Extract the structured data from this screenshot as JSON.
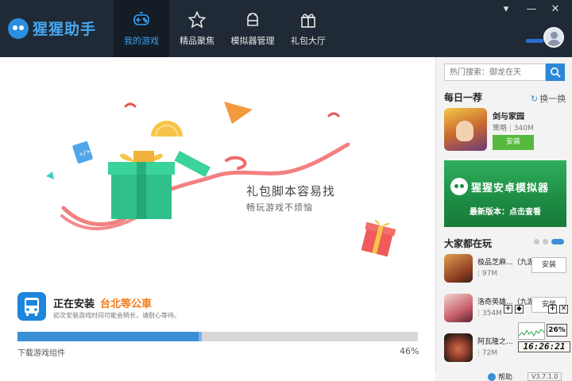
{
  "app": {
    "name": "猩猩助手",
    "nav": [
      {
        "label": "我的游戏",
        "icon": "gamepad-icon",
        "active": true
      },
      {
        "label": "精品聚焦",
        "icon": "star-icon",
        "active": false
      },
      {
        "label": "模拟器管理",
        "icon": "android-icon",
        "active": false
      },
      {
        "label": "礼包大厅",
        "icon": "gift-icon",
        "active": false
      }
    ],
    "window_controls": {
      "menu": "▾",
      "minimize": "—",
      "close": "✕"
    },
    "accent_color": "#3aa2f5"
  },
  "promo": {
    "title": "礼包脚本容易找",
    "subtitle": "畅玩游戏不烦恼"
  },
  "install": {
    "status_label": "正在安装",
    "app_name": "台北等公車",
    "note": "初次安装游戏时间可能会稍长，请耐心等待。",
    "progress_caption": "下载游戏组件",
    "progress_percent": "46%",
    "progress_value": 0.46
  },
  "sidebar": {
    "search_placeholder": "热门搜索：御龙在天",
    "daily_title": "每日一荐",
    "refresh_label": "换一换",
    "featured": {
      "name": "剑与家园",
      "category": "策略",
      "size": "340M",
      "button": "安装"
    },
    "banner": {
      "title": "猩猩安卓模拟器",
      "subtitle": "最新版本：点击查看"
    },
    "popular_title": "大家都在玩",
    "games": [
      {
        "name": "极品芝麻...（九游",
        "size": "97M",
        "button": "安装"
      },
      {
        "name": "洛奇英雄...（九游",
        "size": "354M",
        "button": "安装"
      },
      {
        "name": "阿瓦隆之...",
        "size": "72M",
        "button": ""
      }
    ]
  },
  "statusbar": {
    "help": "帮助",
    "version": "V3.7.1.0"
  },
  "widget": {
    "cpu": "26%",
    "clock": "16:26:21"
  }
}
